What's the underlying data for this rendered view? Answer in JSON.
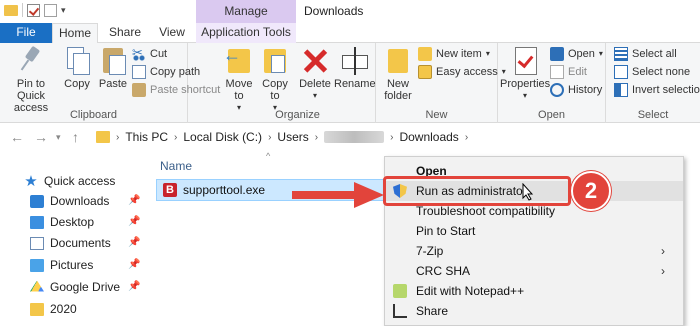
{
  "window": {
    "title": "Downloads",
    "manage_tab": "Manage"
  },
  "tabs": {
    "file": "File",
    "home": "Home",
    "share": "Share",
    "view": "View",
    "app_tools": "Application Tools"
  },
  "ribbon": {
    "clipboard": {
      "label": "Clipboard",
      "pin_to_quick_access": "Pin to Quick access",
      "copy": "Copy",
      "paste": "Paste",
      "cut": "Cut",
      "copy_path": "Copy path",
      "paste_shortcut": "Paste shortcut"
    },
    "organize": {
      "label": "Organize",
      "move_to": "Move to",
      "copy_to": "Copy to",
      "delete": "Delete",
      "rename": "Rename"
    },
    "new": {
      "label": "New",
      "new_folder": "New folder",
      "new_item": "New item",
      "easy_access": "Easy access"
    },
    "open": {
      "label": "Open",
      "properties": "Properties",
      "open": "Open",
      "edit": "Edit",
      "history": "History"
    },
    "select": {
      "label": "Select",
      "select_all": "Select all",
      "select_none": "Select none",
      "invert_selection": "Invert selection"
    }
  },
  "address": {
    "crumbs": [
      "This PC",
      "Local Disk (C:)",
      "Users",
      "Downloads"
    ]
  },
  "nav": {
    "items": [
      {
        "label": "Quick access",
        "icon": "star-icon",
        "pinned": false
      },
      {
        "label": "Downloads",
        "icon": "downloads-icon",
        "pinned": true
      },
      {
        "label": "Desktop",
        "icon": "desktop-icon",
        "pinned": true
      },
      {
        "label": "Documents",
        "icon": "documents-icon",
        "pinned": true
      },
      {
        "label": "Pictures",
        "icon": "pictures-icon",
        "pinned": true
      },
      {
        "label": "Google Drive",
        "icon": "google-drive-icon",
        "pinned": true
      },
      {
        "label": "2020",
        "icon": "folder-icon",
        "pinned": false
      }
    ]
  },
  "filelist": {
    "column_name": "Name",
    "selected_file": "supporttool.exe",
    "file_icon_letter": "B"
  },
  "context_menu": {
    "items": [
      {
        "label": "Open",
        "bold": true
      },
      {
        "label": "Run as administrator",
        "highlighted": true
      },
      {
        "label": "Troubleshoot compatibility"
      },
      {
        "label": "Pin to Start"
      },
      {
        "label": "7-Zip",
        "submenu": true
      },
      {
        "label": "CRC SHA",
        "submenu": true
      },
      {
        "label": "Edit with Notepad++"
      },
      {
        "label": "Share"
      }
    ]
  },
  "annotation": {
    "step_number": "2",
    "color": "#e2443b"
  }
}
